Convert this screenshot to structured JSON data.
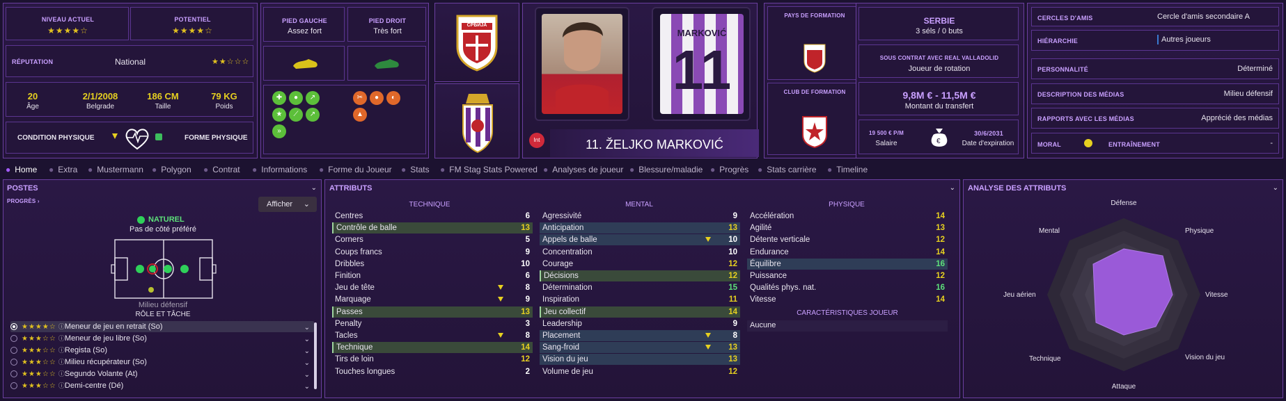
{
  "top": {
    "current_level_label": "NIVEAU ACTUEL",
    "current_level_stars": "★★★★☆",
    "potential_label": "POTENTIEL",
    "potential_stars": "★★★★☆",
    "reputation_label": "RÉPUTATION",
    "reputation_value": "National",
    "reputation_stars": "★★☆☆☆",
    "age": "20",
    "age_label": "Âge",
    "birth": "2/1/2008",
    "birth_place": "Belgrade",
    "height": "186 CM",
    "height_label": "Taille",
    "weight": "79 KG",
    "weight_label": "Poids",
    "condition_label": "CONDITION PHYSIQUE",
    "form_label": "FORME PHYSIQUE",
    "left_foot_label": "PIED GAUCHE",
    "left_foot_value": "Assez fort",
    "right_foot_label": "PIED DROIT",
    "right_foot_value": "Très fort",
    "player_name": "11. ŽELJKO MARKOVIĆ",
    "int_badge": "Int",
    "shirt_name": "MARKOVIĆ",
    "shirt_number": "11",
    "flag_text": "СРБИЈА",
    "formation_country_label": "PAYS DE FORMATION",
    "formation_club_label": "CLUB DE FORMATION",
    "nation": "SERBIE",
    "caps": "3 séls / 0 buts",
    "contract_label": "SOUS CONTRAT AVEC REAL VALLADOLID",
    "contract_role": "Joueur de rotation",
    "transfer_value": "9,8M € - 11,5M €",
    "transfer_label": "Montant du transfert",
    "salary": "19 500 € P/M",
    "salary_label": "Salaire",
    "expiry": "30/6/2031",
    "expiry_label": "Date d'expiration"
  },
  "info": [
    {
      "label": "CERCLES D'AMIS",
      "value": "Cercle d'amis secondaire A"
    },
    {
      "label": "HIÉRARCHIE",
      "value": "Autres joueurs"
    },
    {
      "label": "PERSONNALITÉ",
      "value": "Déterminé"
    },
    {
      "label": "DESCRIPTION DES MÉDIAS",
      "value": "Milieu défensif"
    },
    {
      "label": "RAPPORTS AVEC LES MÉDIAS",
      "value": "Apprécié des médias"
    },
    {
      "label": "MORAL",
      "value": ""
    },
    {
      "label": "ENTRAÎNEMENT",
      "value": "-"
    }
  ],
  "tabs": [
    "Home",
    "Extra",
    "Mustermann",
    "Polygon",
    "Contrat",
    "Informations",
    "Forme du Joueur",
    "Stats",
    "FM Stag Stats Powered",
    "Analyses de joueur",
    "Blessure/maladie",
    "Progrès",
    "Stats carrière",
    "Timeline"
  ],
  "positions": {
    "title": "POSTES",
    "progress_link": "PROGRÈS",
    "show_button": "Afficher",
    "natural": "NATUREL",
    "side_pref": "Pas de côté préféré",
    "role_name": "Milieu défensif",
    "role_title": "RÔLE ET TÂCHE",
    "roles": [
      {
        "stars": "★★★★☆",
        "label": "Meneur de jeu en retrait (So)"
      },
      {
        "stars": "★★★☆☆",
        "label": "Meneur de jeu libre (So)"
      },
      {
        "stars": "★★★☆☆",
        "label": "Regista (So)"
      },
      {
        "stars": "★★★☆☆",
        "label": "Milieu récupérateur (So)"
      },
      {
        "stars": "★★★☆☆",
        "label": "Segundo Volante (At)"
      },
      {
        "stars": "★★★☆☆",
        "label": "Demi-centre (Dé)"
      }
    ]
  },
  "attributes": {
    "title": "ATTRIBUTS",
    "technique_title": "TECHNIQUE",
    "mental_title": "MENTAL",
    "physique_title": "PHYSIQUE",
    "traits_title": "CARACTÉRISTIQUES JOUEUR",
    "traits_value": "Aucune",
    "technique": [
      {
        "n": "Centres",
        "v": "6"
      },
      {
        "n": "Contrôle de balle",
        "v": "13"
      },
      {
        "n": "Corners",
        "v": "5"
      },
      {
        "n": "Coups francs",
        "v": "9"
      },
      {
        "n": "Dribbles",
        "v": "10"
      },
      {
        "n": "Finition",
        "v": "6"
      },
      {
        "n": "Jeu de tête",
        "v": "8"
      },
      {
        "n": "Marquage",
        "v": "9"
      },
      {
        "n": "Passes",
        "v": "13"
      },
      {
        "n": "Penalty",
        "v": "3"
      },
      {
        "n": "Tacles",
        "v": "8"
      },
      {
        "n": "Technique",
        "v": "14"
      },
      {
        "n": "Tirs de loin",
        "v": "12"
      },
      {
        "n": "Touches longues",
        "v": "2"
      }
    ],
    "mental": [
      {
        "n": "Agressivité",
        "v": "9"
      },
      {
        "n": "Anticipation",
        "v": "13"
      },
      {
        "n": "Appels de balle",
        "v": "10"
      },
      {
        "n": "Concentration",
        "v": "10"
      },
      {
        "n": "Courage",
        "v": "12"
      },
      {
        "n": "Décisions",
        "v": "12"
      },
      {
        "n": "Détermination",
        "v": "15"
      },
      {
        "n": "Inspiration",
        "v": "11"
      },
      {
        "n": "Jeu collectif",
        "v": "14"
      },
      {
        "n": "Leadership",
        "v": "9"
      },
      {
        "n": "Placement",
        "v": "8"
      },
      {
        "n": "Sang-froid",
        "v": "13"
      },
      {
        "n": "Vision du jeu",
        "v": "13"
      },
      {
        "n": "Volume de jeu",
        "v": "12"
      }
    ],
    "physique": [
      {
        "n": "Accélération",
        "v": "14"
      },
      {
        "n": "Agilité",
        "v": "13"
      },
      {
        "n": "Détente verticale",
        "v": "12"
      },
      {
        "n": "Endurance",
        "v": "14"
      },
      {
        "n": "Équilibre",
        "v": "16"
      },
      {
        "n": "Puissance",
        "v": "12"
      },
      {
        "n": "Qualités phys. nat.",
        "v": "16"
      },
      {
        "n": "Vitesse",
        "v": "14"
      }
    ]
  },
  "analysis": {
    "title": "ANALYSE DES ATTRIBUTS",
    "labels": {
      "top": "Défense",
      "tr": "Physique",
      "r": "Vitesse",
      "br": "Vision du jeu",
      "bottom": "Attaque",
      "bl": "Technique",
      "l": "Jeu aérien",
      "tl": "Mental"
    }
  },
  "colors": {
    "accent": "#a45cff",
    "panel": "#24153a",
    "border": "#6b3fa0",
    "yellow": "#e6d020",
    "green": "#5de07a"
  }
}
